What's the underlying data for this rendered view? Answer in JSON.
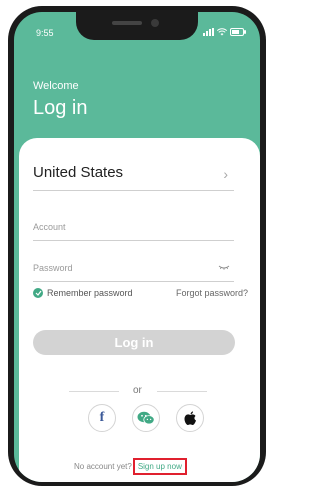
{
  "status_bar": {
    "time": "9:55"
  },
  "header": {
    "welcome": "Welcome",
    "title": "Log in"
  },
  "country": {
    "value": "United States"
  },
  "account": {
    "placeholder": "Account"
  },
  "password": {
    "placeholder": "Password"
  },
  "remember": {
    "label": "Remember password"
  },
  "forgot": {
    "label": "Forgot password?"
  },
  "login_button": {
    "label": "Log in"
  },
  "divider": {
    "text": "or"
  },
  "social": {
    "facebook": "f"
  },
  "signup": {
    "prompt": "No account yet?",
    "link": "Sign up now"
  },
  "colors": {
    "brand": "#5bb99a",
    "accent": "#41a985",
    "highlight": "#e0202e"
  },
  "icons": [
    "signal-icon",
    "wifi-icon",
    "battery-icon",
    "chevron-right-icon",
    "eye-closed-icon",
    "check-circle-icon",
    "facebook-icon",
    "wechat-icon",
    "apple-icon"
  ]
}
